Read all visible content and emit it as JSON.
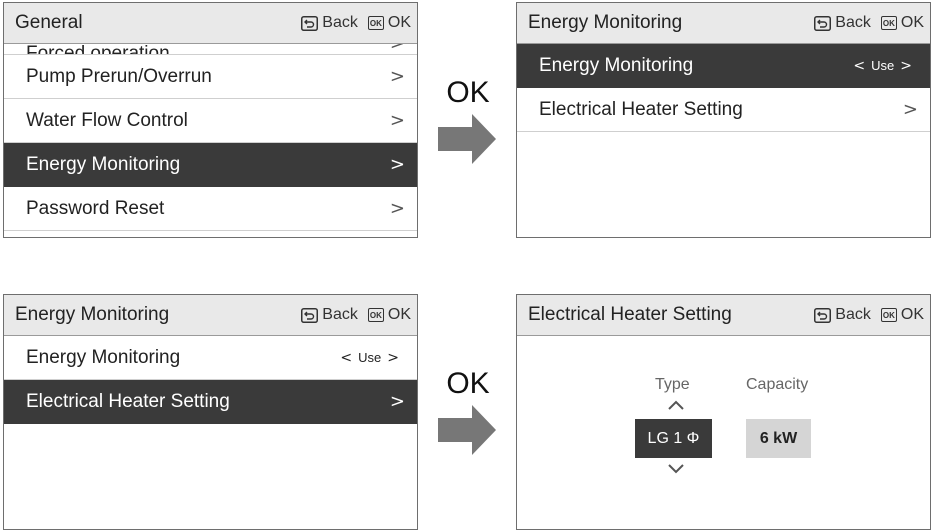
{
  "screen1": {
    "title": "General",
    "back_label": "Back",
    "ok_label": "OK",
    "items": [
      {
        "label": "Forced operation"
      },
      {
        "label": "Pump Prerun/Overrun"
      },
      {
        "label": "Water Flow Control"
      },
      {
        "label": "Energy Monitoring"
      },
      {
        "label": "Password Reset"
      }
    ]
  },
  "screen2": {
    "title": "Energy Monitoring",
    "back_label": "Back",
    "ok_label": "OK",
    "items": [
      {
        "label": "Energy Monitoring",
        "value": "Use"
      },
      {
        "label": "Electrical Heater Setting"
      }
    ]
  },
  "screen3": {
    "title": "Energy Monitoring",
    "back_label": "Back",
    "ok_label": "OK",
    "items": [
      {
        "label": "Energy Monitoring",
        "value": "Use"
      },
      {
        "label": "Electrical Heater Setting"
      }
    ]
  },
  "screen4": {
    "title": "Electrical Heater Setting",
    "back_label": "Back",
    "ok_label": "OK",
    "type_label": "Type",
    "capacity_label": "Capacity",
    "type_value": "LG 1 Φ",
    "capacity_value": "6 kW"
  },
  "transitions": [
    {
      "label": "OK"
    },
    {
      "label": "OK"
    }
  ],
  "glyphs": {
    "ok_icon": "OK",
    "chevron": ">",
    "left": "<",
    "right": ">"
  },
  "colors": {
    "header_bg": "#e9e9e9",
    "selected_bg": "#3a3a3a",
    "arrow": "#777777",
    "capacity_bg": "#d5d5d5"
  },
  "icons": [
    "back-icon",
    "ok-icon",
    "chevron-right-icon",
    "chevron-left-icon",
    "chevron-up-icon",
    "chevron-down-icon",
    "right-arrow-icon"
  ]
}
